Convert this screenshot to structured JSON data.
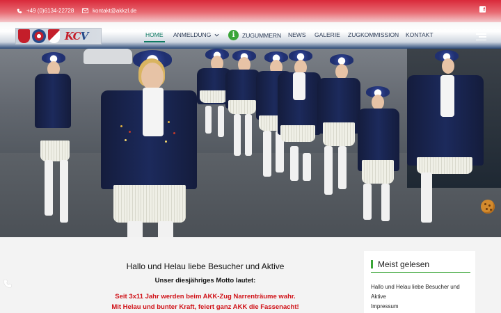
{
  "topbar": {
    "phone": "+49 (0)6134-22728",
    "email": "kontakt@akkzl.de",
    "social_icon": "facebook-icon"
  },
  "logo": {
    "text_k": "KC",
    "text_v": "V"
  },
  "nav": {
    "items": [
      {
        "label": "HOME",
        "active": true
      },
      {
        "label": "ANMELDUNG",
        "dropdown": true
      },
      {
        "label": "ZUGUMMERN",
        "icon": "info-icon"
      },
      {
        "label": "NEWS"
      },
      {
        "label": "GALERIE"
      },
      {
        "label": "ZUGKOMMISSION"
      },
      {
        "label": "KONTAKT"
      }
    ]
  },
  "hero": {
    "image_subject": "carnival marching group in blue coats and white skirts"
  },
  "main": {
    "heading": "Hallo und Helau liebe Besucher und Aktive",
    "motto_intro": "Unser diesjähriges Motto lautet:",
    "motto_line1": "Seit 3x11 Jahr werden beim AKK-Zug Narrenträume wahr.",
    "motto_line2": "Mit Helau und bunter Kraft, feiert ganz AKK die Fassenacht!"
  },
  "sidebar": {
    "title": "Meist gelesen",
    "links": [
      "Hallo und Helau liebe Besucher und Aktive",
      "Impressum"
    ]
  },
  "colors": {
    "accent_green": "#3aa537",
    "topbar_red": "#d9293a",
    "motto_red": "#d01218",
    "active_nav": "#0f7a63"
  }
}
